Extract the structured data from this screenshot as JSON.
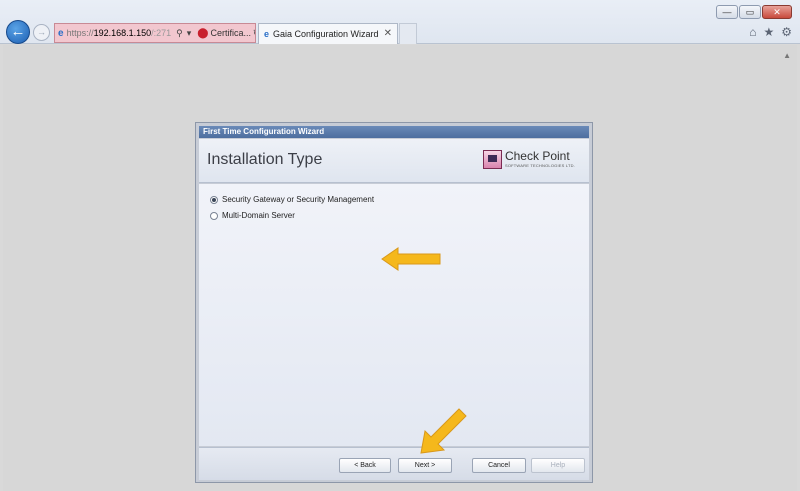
{
  "browser": {
    "address": {
      "protocol": "https://",
      "host": "192.168.1.150",
      "rest": "/:271",
      "cert_label": "Certifica..."
    },
    "tab": {
      "title": "Gaia Configuration Wizard",
      "close": "✕"
    },
    "window_controls": {
      "minimize": "—",
      "maximize": "▭",
      "close": "✕"
    },
    "icons": [
      "home-icon",
      "star-icon",
      "gear-icon"
    ]
  },
  "wizard": {
    "window_title": "First Time Configuration Wizard",
    "heading": "Installation Type",
    "logo": {
      "name": "Check Point",
      "tagline": "SOFTWARE TECHNOLOGIES LTD."
    },
    "options": [
      {
        "label": "Security Gateway or Security Management",
        "selected": true
      },
      {
        "label": "Multi-Domain Server",
        "selected": false
      }
    ],
    "buttons": {
      "back": "< Back",
      "next": "Next >",
      "cancel": "Cancel",
      "help": "Help"
    }
  },
  "annotation_color": "#f5b81c"
}
